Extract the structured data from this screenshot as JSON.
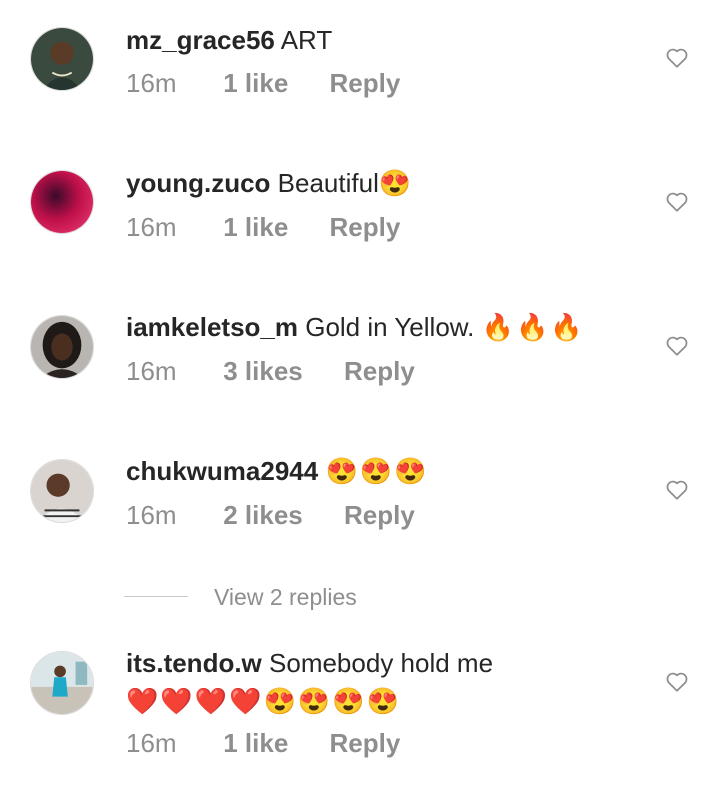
{
  "comments": [
    {
      "username": "mz_grace56",
      "text": "ART",
      "emoji": "",
      "time": "16m",
      "likes": "1 like",
      "reply": "Reply"
    },
    {
      "username": "young.zuco",
      "text": "Beautiful",
      "emoji": "😍",
      "time": "16m",
      "likes": "1 like",
      "reply": "Reply"
    },
    {
      "username": "iamkeletso_m",
      "text": "Gold in Yellow. ",
      "emoji": "🔥🔥🔥",
      "time": "16m",
      "likes": "3 likes",
      "reply": "Reply"
    },
    {
      "username": "chukwuma2944",
      "text": "",
      "emoji": "😍😍😍",
      "time": "16m",
      "likes": "2 likes",
      "reply": "Reply"
    },
    {
      "username": "its.tendo.w",
      "text": "Somebody hold me",
      "emoji": "❤️❤️❤️❤️😍😍😍😍",
      "time": "16m",
      "likes": "1 like",
      "reply": "Reply"
    }
  ],
  "view_replies": "View 2 replies",
  "icons": {
    "like": "heart-outline-icon"
  },
  "colors": {
    "text": "#262626",
    "secondary": "#8e8e8e"
  }
}
